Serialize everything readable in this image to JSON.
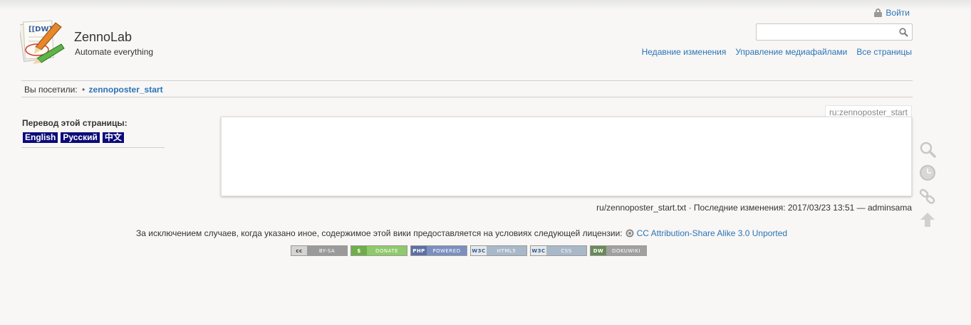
{
  "site": {
    "title": "ZennoLab",
    "tagline": "Automate everything",
    "logo_icon": "dokuwiki-logo-icon"
  },
  "user": {
    "login_label": "Войти"
  },
  "search": {
    "value": "",
    "placeholder": ""
  },
  "tools": {
    "recent": "Недавние изменения",
    "media": "Управление медиафайлами",
    "index": "Все страницы"
  },
  "breadcrumb": {
    "label": "Вы посетили:",
    "bullet": "•",
    "item": "zennoposter_start"
  },
  "sidebar": {
    "heading": "Перевод этой страницы:",
    "languages": [
      "English",
      "Русский",
      "中文"
    ]
  },
  "page": {
    "id": "ru:zennoposter_start"
  },
  "docinfo": {
    "text": "ru/zennoposter_start.txt · Последние изменения: 2017/03/23 13:51 — adminsama"
  },
  "footer": {
    "license_text": "За исключением случаев, когда указано иное, содержимое этой вики предоставляется на условиях следующей лицензии:",
    "license_link": "CC Attribution-Share Alike 3.0 Unported",
    "buttons": [
      {
        "left": "cc",
        "right": "BY-SA",
        "color": "#9a9a9a"
      },
      {
        "left": "$",
        "right": "DONATE",
        "color": "#8ec96b"
      },
      {
        "left": "PHP",
        "right": "POWERED",
        "color": "#7b8fbf"
      },
      {
        "left": "W3C",
        "right": "HTML5",
        "color": "#a9b8c9"
      },
      {
        "left": "W3C",
        "right": "CSS",
        "color": "#a9b8c9"
      },
      {
        "left": "DW",
        "right": "DOKUWIKI",
        "color": "#a0a0a0"
      }
    ]
  },
  "colors": {
    "link": "#2b73b7",
    "lang_bg": "#0b0b7a",
    "background": "#f8f7f5"
  },
  "pagetool_icons": [
    "search-icon",
    "clock-icon",
    "chain-link-icon",
    "arrow-up-icon"
  ]
}
